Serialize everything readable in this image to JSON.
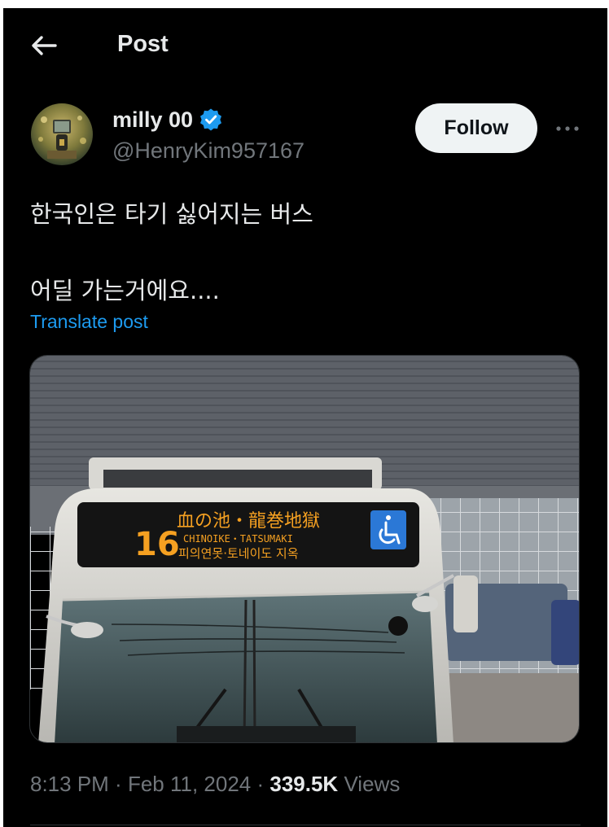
{
  "header": {
    "title": "Post",
    "back_icon": "arrow-left-icon"
  },
  "author": {
    "name": "milly 00",
    "handle": "@HenryKim957167",
    "verified": true,
    "verified_icon": "verified-badge-icon",
    "follow_label": "Follow",
    "more_icon": "more-horizontal-icon"
  },
  "post": {
    "line1": "한국인은 타기 싫어지는 버스",
    "line2": "어딜 가는거에요....",
    "translate_label": "Translate post"
  },
  "media": {
    "bus_route_number": "16",
    "sign_japanese": "血の池・龍巻地獄",
    "sign_romaji": "CHINOIKE・TATSUMAKI",
    "sign_korean": "피의연못·토네이도 지옥",
    "accessibility_icon": "wheelchair-icon"
  },
  "meta": {
    "time": "8:13 PM",
    "separator": " · ",
    "date": "Feb 11, 2024",
    "views_count": "339.5K",
    "views_label": "Views"
  },
  "colors": {
    "background": "#000000",
    "text_primary": "#e7e9ea",
    "text_secondary": "#71767b",
    "accent": "#1d9bf0",
    "follow_bg": "#eff3f4"
  }
}
